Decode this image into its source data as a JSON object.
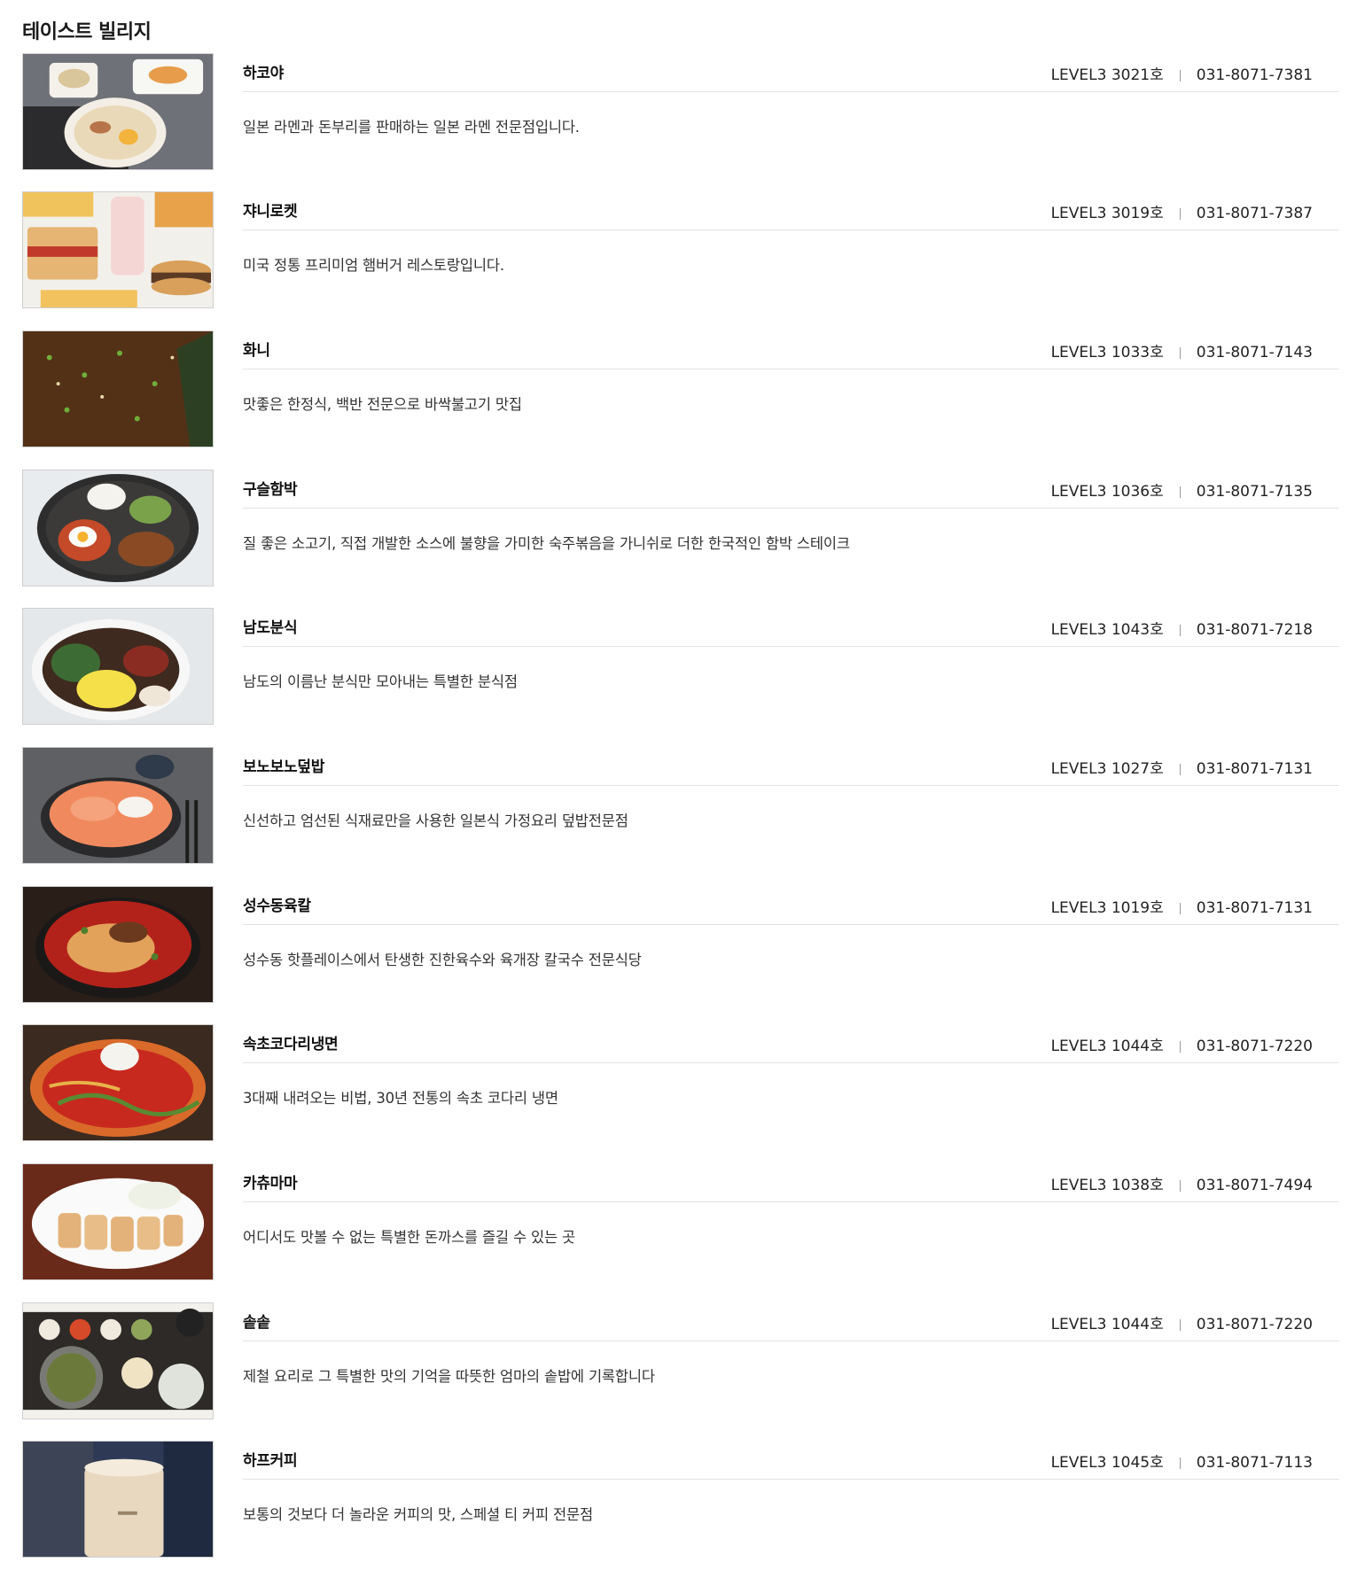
{
  "section": {
    "title": "테이스트 빌리지"
  },
  "restaurants": [
    {
      "name": "하코야",
      "location": "LEVEL3  3021호",
      "phone": "031-8071-7381",
      "description": "일본 라멘과 돈부리를 판매하는 일본 라멘 전문점입니다.",
      "image": "ramen-photo"
    },
    {
      "name": "쟈니로켓",
      "location": "LEVEL3 3019호",
      "phone": "031-8071-7387",
      "description": "미국 정통 프리미엄 햄버거 레스토랑입니다.",
      "image": "burger-photo"
    },
    {
      "name": "화니",
      "location": "LEVEL3  1033호",
      "phone": "031-8071-7143",
      "description": "맛좋은 한정식, 백반 전문으로 바싹불고기 맛집",
      "image": "bulgogi-photo"
    },
    {
      "name": "구슬함박",
      "location": "LEVEL3 1036호",
      "phone": "031-8071-7135",
      "description": "질 좋은 소고기, 직접 개발한 소스에 불향을 가미한 숙주볶음을 가니쉬로 더한 한국적인 함박 스테이크",
      "image": "hamburg-steak-photo"
    },
    {
      "name": "남도분식",
      "location": "LEVEL3 1043호",
      "phone": "031-8071-7218",
      "description": "남도의 이름난 분식만 모아내는 특별한 분식점",
      "image": "noodle-bowl-photo"
    },
    {
      "name": "보노보노덮밥",
      "location": "LEVEL3 1027호",
      "phone": "031-8071-7131",
      "description": "신선하고 엄선된 식재료만을 사용한 일본식 가정요리 덮밥전문점",
      "image": "salmon-donburi-photo"
    },
    {
      "name": "성수동육칼",
      "location": "LEVEL3 1019호",
      "phone": "031-8071-7131",
      "description": "성수동 핫플레이스에서 탄생한 진한육수와 육개장 칼국수 전문식당",
      "image": "spicy-noodle-photo"
    },
    {
      "name": "속초코다리냉면",
      "location": "LEVEL3 1044호",
      "phone": "031-8071-7220",
      "description": "3대째 내려오는 비법, 30년 전통의 속초 코다리 냉면",
      "image": "naengmyeon-photo"
    },
    {
      "name": "카츄마마",
      "location": "LEVEL3 1038호",
      "phone": "031-8071-7494",
      "description": "어디서도 맛볼 수 없는 특별한 돈까스를 즐길 수 있는 곳",
      "image": "tonkatsu-photo"
    },
    {
      "name": "솥솥",
      "location": "LEVEL3 1044호",
      "phone": "031-8071-7220",
      "description": "제철 요리로 그 특별한 맛의 기억을 따뜻한 엄마의 솥밥에 기록합니다",
      "image": "sotbap-photo"
    },
    {
      "name": "하프커피",
      "location": "LEVEL3 1045호",
      "phone": "031-8071-7113",
      "description": "보통의 것보다 더 놀라운 커피의 맛, 스페셜 티 커피 전문점",
      "image": "coffee-cup-photo"
    }
  ]
}
